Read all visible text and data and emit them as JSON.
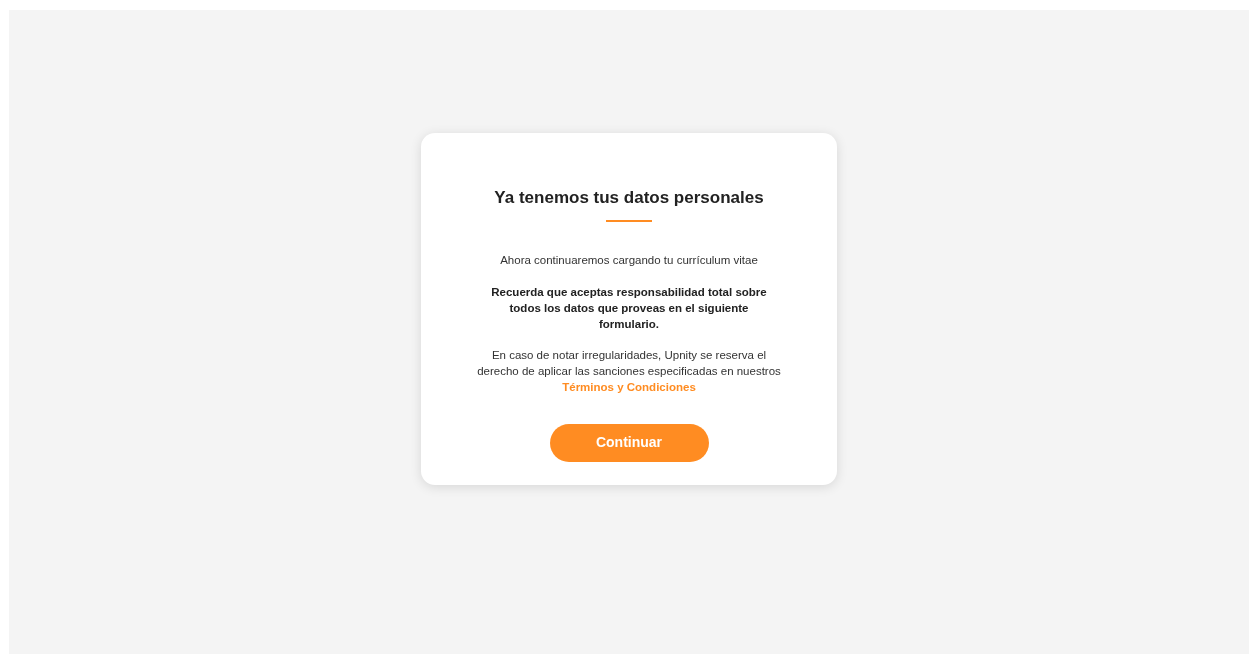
{
  "card": {
    "title": "Ya tenemos tus datos personales",
    "intro": "Ahora continuaremos cargando tu currículum vitae",
    "notice": "Recuerda que aceptas responsabilidad total sobre todos los datos que proveas en el siguiente formulario.",
    "warning": "En caso de notar irregularidades, Upnity se reserva el derecho de aplicar las sanciones especificadas en nuestros",
    "terms_link": "Términos y Condiciones",
    "button": "Continuar"
  }
}
